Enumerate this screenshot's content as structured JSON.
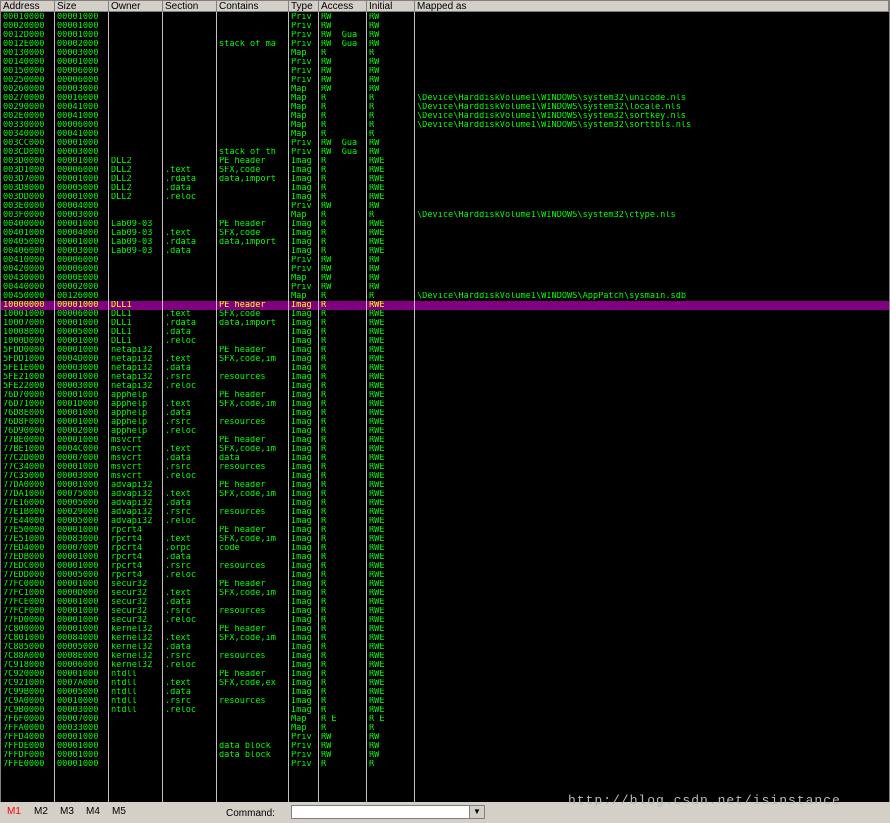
{
  "columns": [
    "Address",
    "Size",
    "Owner",
    "Section",
    "Contains",
    "Type",
    "Access",
    "Initial",
    "Mapped as"
  ],
  "rows": [
    [
      "00010000",
      "00001000",
      "",
      "",
      "",
      "Priv",
      "RW",
      "RW",
      ""
    ],
    [
      "00020000",
      "00001000",
      "",
      "",
      "",
      "Priv",
      "RW",
      "RW",
      ""
    ],
    [
      "0012D000",
      "00001000",
      "",
      "",
      "",
      "Priv",
      "RW  Gua",
      "RW",
      ""
    ],
    [
      "0012E000",
      "00002000",
      "",
      "",
      "stack of ma",
      "Priv",
      "RW  Gua",
      "RW",
      ""
    ],
    [
      "00130000",
      "00003000",
      "",
      "",
      "",
      "Map",
      "R",
      "R",
      ""
    ],
    [
      "00140000",
      "00001000",
      "",
      "",
      "",
      "Priv",
      "RW",
      "RW",
      ""
    ],
    [
      "00150000",
      "00006000",
      "",
      "",
      "",
      "Priv",
      "RW",
      "RW",
      ""
    ],
    [
      "00250000",
      "00006000",
      "",
      "",
      "",
      "Priv",
      "RW",
      "RW",
      ""
    ],
    [
      "00260000",
      "00003000",
      "",
      "",
      "",
      "Map",
      "RW",
      "RW",
      ""
    ],
    [
      "00270000",
      "00016000",
      "",
      "",
      "",
      "Map",
      "R",
      "R",
      "\\Device\\HarddiskVolume1\\WINDOWS\\system32\\unicode.nls"
    ],
    [
      "00290000",
      "00041000",
      "",
      "",
      "",
      "Map",
      "R",
      "R",
      "\\Device\\HarddiskVolume1\\WINDOWS\\system32\\locale.nls"
    ],
    [
      "002E0000",
      "00041000",
      "",
      "",
      "",
      "Map",
      "R",
      "R",
      "\\Device\\HarddiskVolume1\\WINDOWS\\system32\\sortkey.nls"
    ],
    [
      "00330000",
      "00006000",
      "",
      "",
      "",
      "Map",
      "R",
      "R",
      "\\Device\\HarddiskVolume1\\WINDOWS\\system32\\sorttbls.nls"
    ],
    [
      "00340000",
      "00041000",
      "",
      "",
      "",
      "Map",
      "R",
      "R",
      ""
    ],
    [
      "003CC000",
      "00001000",
      "",
      "",
      "",
      "Priv",
      "RW  Gua",
      "RW",
      ""
    ],
    [
      "003CD000",
      "00003000",
      "",
      "",
      "stack of th",
      "Priv",
      "RW  Gua",
      "RW",
      ""
    ],
    [
      "003D0000",
      "00001000",
      "DLL2",
      "",
      "PE header",
      "Imag",
      "R",
      "RWE",
      ""
    ],
    [
      "003D1000",
      "00006000",
      "DLL2",
      ".text",
      "SFX,code",
      "Imag",
      "R",
      "RWE",
      ""
    ],
    [
      "003D7000",
      "00001000",
      "DLL2",
      ".rdata",
      "data,import",
      "Imag",
      "R",
      "RWE",
      ""
    ],
    [
      "003D8000",
      "00005000",
      "DLL2",
      ".data",
      "",
      "Imag",
      "R",
      "RWE",
      ""
    ],
    [
      "003DD000",
      "00001000",
      "DLL2",
      ".reloc",
      "",
      "Imag",
      "R",
      "RWE",
      ""
    ],
    [
      "003E0000",
      "00004000",
      "",
      "",
      "",
      "Priv",
      "RW",
      "RW",
      ""
    ],
    [
      "003F0000",
      "00003000",
      "",
      "",
      "",
      "Map",
      "R",
      "R",
      "\\Device\\HarddiskVolume1\\WINDOWS\\system32\\ctype.nls"
    ],
    [
      "00400000",
      "00001000",
      "Lab09-03",
      "",
      "PE header",
      "Imag",
      "R",
      "RWE",
      ""
    ],
    [
      "00401000",
      "00004000",
      "Lab09-03",
      ".text",
      "SFX,code",
      "Imag",
      "R",
      "RWE",
      ""
    ],
    [
      "00405000",
      "00001000",
      "Lab09-03",
      ".rdata",
      "data,import",
      "Imag",
      "R",
      "RWE",
      ""
    ],
    [
      "00406000",
      "00003000",
      "Lab09-03",
      ".data",
      "",
      "Imag",
      "R",
      "RWE",
      ""
    ],
    [
      "00410000",
      "00006000",
      "",
      "",
      "",
      "Priv",
      "RW",
      "RW",
      ""
    ],
    [
      "00420000",
      "00006000",
      "",
      "",
      "",
      "Priv",
      "RW",
      "RW",
      ""
    ],
    [
      "00430000",
      "0000E000",
      "",
      "",
      "",
      "Map",
      "RW",
      "RW",
      ""
    ],
    [
      "00440000",
      "00002000",
      "",
      "",
      "",
      "Priv",
      "RW",
      "RW",
      ""
    ],
    [
      "00450000",
      "00126000",
      "",
      "",
      "",
      "Map",
      "R",
      "R",
      "\\Device\\HarddiskVolume1\\WINDOWS\\AppPatch\\sysmain.sdb"
    ],
    [
      "10000000",
      "00001000",
      "DLL1",
      "",
      "PE header",
      "Imag",
      "R",
      "RWE",
      ""
    ],
    [
      "10001000",
      "00006000",
      "DLL1",
      ".text",
      "SFX,code",
      "Imag",
      "R",
      "RWE",
      ""
    ],
    [
      "10007000",
      "00001000",
      "DLL1",
      ".rdata",
      "data,import",
      "Imag",
      "R",
      "RWE",
      ""
    ],
    [
      "10008000",
      "00005000",
      "DLL1",
      ".data",
      "",
      "Imag",
      "R",
      "RWE",
      ""
    ],
    [
      "1000D000",
      "00001000",
      "DLL1",
      ".reloc",
      "",
      "Imag",
      "R",
      "RWE",
      ""
    ],
    [
      "5FDD0000",
      "00001000",
      "netapi32",
      "",
      "PE header",
      "Imag",
      "R",
      "RWE",
      ""
    ],
    [
      "5FDD1000",
      "0004D000",
      "netapi32",
      ".text",
      "SFX,code,im",
      "Imag",
      "R",
      "RWE",
      ""
    ],
    [
      "5FE1E000",
      "00003000",
      "netapi32",
      ".data",
      "",
      "Imag",
      "R",
      "RWE",
      ""
    ],
    [
      "5FE21000",
      "00001000",
      "netapi32",
      ".rsrc",
      "resources",
      "Imag",
      "R",
      "RWE",
      ""
    ],
    [
      "5FE22000",
      "00003000",
      "netapi32",
      ".reloc",
      "",
      "Imag",
      "R",
      "RWE",
      ""
    ],
    [
      "76D70000",
      "00001000",
      "apphelp",
      "",
      "PE header",
      "Imag",
      "R",
      "RWE",
      ""
    ],
    [
      "76D71000",
      "0001D000",
      "apphelp",
      ".text",
      "SFX,code,im",
      "Imag",
      "R",
      "RWE",
      ""
    ],
    [
      "76D8E000",
      "00001000",
      "apphelp",
      ".data",
      "",
      "Imag",
      "R",
      "RWE",
      ""
    ],
    [
      "76D8F000",
      "00001000",
      "apphelp",
      ".rsrc",
      "resources",
      "Imag",
      "R",
      "RWE",
      ""
    ],
    [
      "76D90000",
      "00002000",
      "apphelp",
      ".reloc",
      "",
      "Imag",
      "R",
      "RWE",
      ""
    ],
    [
      "77BE0000",
      "00001000",
      "msvcrt",
      "",
      "PE header",
      "Imag",
      "R",
      "RWE",
      ""
    ],
    [
      "77BE1000",
      "0004C000",
      "msvcrt",
      ".text",
      "SFX,code,im",
      "Imag",
      "R",
      "RWE",
      ""
    ],
    [
      "77C2D000",
      "00007000",
      "msvcrt",
      ".data",
      "data",
      "Imag",
      "R",
      "RWE",
      ""
    ],
    [
      "77C34000",
      "00001000",
      "msvcrt",
      ".rsrc",
      "resources",
      "Imag",
      "R",
      "RWE",
      ""
    ],
    [
      "77C35000",
      "00003000",
      "msvcrt",
      ".reloc",
      "",
      "Imag",
      "R",
      "RWE",
      ""
    ],
    [
      "77DA0000",
      "00001000",
      "advapi32",
      "",
      "PE header",
      "Imag",
      "R",
      "RWE",
      ""
    ],
    [
      "77DA1000",
      "00075000",
      "advapi32",
      ".text",
      "SFX,code,im",
      "Imag",
      "R",
      "RWE",
      ""
    ],
    [
      "77E16000",
      "00005000",
      "advapi32",
      ".data",
      "",
      "Imag",
      "R",
      "RWE",
      ""
    ],
    [
      "77E1B000",
      "00029000",
      "advapi32",
      ".rsrc",
      "resources",
      "Imag",
      "R",
      "RWE",
      ""
    ],
    [
      "77E44000",
      "00005000",
      "advapi32",
      ".reloc",
      "",
      "Imag",
      "R",
      "RWE",
      ""
    ],
    [
      "77E50000",
      "00001000",
      "rpcrt4",
      "",
      "PE header",
      "Imag",
      "R",
      "RWE",
      ""
    ],
    [
      "77E51000",
      "00083000",
      "rpcrt4",
      ".text",
      "SFX,code,im",
      "Imag",
      "R",
      "RWE",
      ""
    ],
    [
      "77ED4000",
      "00007000",
      "rpcrt4",
      ".orpc",
      "code",
      "Imag",
      "R",
      "RWE",
      ""
    ],
    [
      "77EDB000",
      "00001000",
      "rpcrt4",
      ".data",
      "",
      "Imag",
      "R",
      "RWE",
      ""
    ],
    [
      "77EDC000",
      "00001000",
      "rpcrt4",
      ".rsrc",
      "resources",
      "Imag",
      "R",
      "RWE",
      ""
    ],
    [
      "77EDD000",
      "00005000",
      "rpcrt4",
      ".reloc",
      "",
      "Imag",
      "R",
      "RWE",
      ""
    ],
    [
      "77FC0000",
      "00001000",
      "secur32",
      "",
      "PE header",
      "Imag",
      "R",
      "RWE",
      ""
    ],
    [
      "77FC1000",
      "0000D000",
      "secur32",
      ".text",
      "SFX,code,im",
      "Imag",
      "R",
      "RWE",
      ""
    ],
    [
      "77FCE000",
      "00001000",
      "secur32",
      ".data",
      "",
      "Imag",
      "R",
      "RWE",
      ""
    ],
    [
      "77FCF000",
      "00001000",
      "secur32",
      ".rsrc",
      "resources",
      "Imag",
      "R",
      "RWE",
      ""
    ],
    [
      "77FD0000",
      "00001000",
      "secur32",
      ".reloc",
      "",
      "Imag",
      "R",
      "RWE",
      ""
    ],
    [
      "7C800000",
      "00001000",
      "kernel32",
      "",
      "PE header",
      "Imag",
      "R",
      "RWE",
      ""
    ],
    [
      "7C801000",
      "00084000",
      "kernel32",
      ".text",
      "SFX,code,im",
      "Imag",
      "R",
      "RWE",
      ""
    ],
    [
      "7C885000",
      "00005000",
      "kernel32",
      ".data",
      "",
      "Imag",
      "R",
      "RWE",
      ""
    ],
    [
      "7C88A000",
      "0008E000",
      "kernel32",
      ".rsrc",
      "resources",
      "Imag",
      "R",
      "RWE",
      ""
    ],
    [
      "7C918000",
      "00006000",
      "kernel32",
      ".reloc",
      "",
      "Imag",
      "R",
      "RWE",
      ""
    ],
    [
      "7C920000",
      "00001000",
      "ntdll",
      "",
      "PE header",
      "Imag",
      "R",
      "RWE",
      ""
    ],
    [
      "7C921000",
      "0007A000",
      "ntdll",
      ".text",
      "SFX,code,ex",
      "Imag",
      "R",
      "RWE",
      ""
    ],
    [
      "7C99B000",
      "00005000",
      "ntdll",
      ".data",
      "",
      "Imag",
      "R",
      "RWE",
      ""
    ],
    [
      "7C9A0000",
      "00010000",
      "ntdll",
      ".rsrc",
      "resources",
      "Imag",
      "R",
      "RWE",
      ""
    ],
    [
      "7C9B0000",
      "00003000",
      "ntdll",
      ".reloc",
      "",
      "Imag",
      "R",
      "RWE",
      ""
    ],
    [
      "7F6F0000",
      "00007000",
      "",
      "",
      "",
      "Map",
      "R E",
      "R E",
      ""
    ],
    [
      "7FFA0000",
      "00033000",
      "",
      "",
      "",
      "Map",
      "R",
      "R",
      ""
    ],
    [
      "7FFD4000",
      "00001000",
      "",
      "",
      "",
      "Priv",
      "RW",
      "RW",
      ""
    ],
    [
      "7FFDE000",
      "00001000",
      "",
      "",
      "data block",
      "Priv",
      "RW",
      "RW",
      ""
    ],
    [
      "7FFDF000",
      "00001000",
      "",
      "",
      "data block",
      "Priv",
      "RW",
      "RW",
      ""
    ],
    [
      "7FFE0000",
      "00001000",
      "",
      "",
      "",
      "Priv",
      "R",
      "R",
      ""
    ]
  ],
  "selected_row": 32,
  "bottom": {
    "tabs": [
      "M1",
      "M2",
      "M3",
      "M4",
      "M5"
    ],
    "active_tab": "M1",
    "command_label": "Command:",
    "command_value": "",
    "watermark": "http://blog.csdn.net/isinstance"
  },
  "colors": {
    "text": "#00ff00",
    "background": "#000000",
    "selected_bg": "#800080",
    "selected_text": "#ffff00",
    "active_tab": "#ff0000"
  }
}
